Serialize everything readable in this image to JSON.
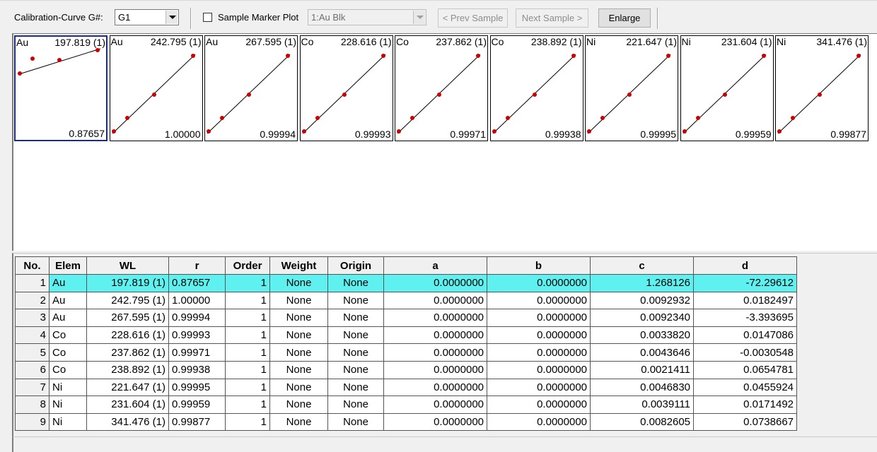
{
  "toolbar": {
    "calib_label": "Calibration-Curve G#:",
    "calib_value": "G1",
    "sample_marker_label": "Sample Marker Plot",
    "sample_marker_checked": false,
    "sample_value": "1:Au Blk",
    "prev_sample": "< Prev Sample",
    "next_sample": "Next Sample >",
    "enlarge": "Enlarge"
  },
  "curves": [
    {
      "elem": "Au",
      "wl": "197.819 (1)",
      "r": "0.87657",
      "selected": true
    },
    {
      "elem": "Au",
      "wl": "242.795 (1)",
      "r": "1.00000"
    },
    {
      "elem": "Au",
      "wl": "267.595 (1)",
      "r": "0.99994"
    },
    {
      "elem": "Co",
      "wl": "228.616 (1)",
      "r": "0.99993"
    },
    {
      "elem": "Co",
      "wl": "237.862 (1)",
      "r": "0.99971"
    },
    {
      "elem": "Co",
      "wl": "238.892 (1)",
      "r": "0.99938"
    },
    {
      "elem": "Ni",
      "wl": "221.647 (1)",
      "r": "0.99995"
    },
    {
      "elem": "Ni",
      "wl": "231.604 (1)",
      "r": "0.99959"
    },
    {
      "elem": "Ni",
      "wl": "341.476 (1)",
      "r": "0.99877"
    }
  ],
  "grid": {
    "headers": [
      "No.",
      "Elem",
      "WL",
      "r",
      "Order",
      "Weight",
      "Origin",
      "a",
      "b",
      "c",
      "d"
    ],
    "selected_row": 0,
    "rows": [
      [
        "1",
        "Au",
        "197.819 (1)",
        "0.87657",
        "1",
        "None",
        "None",
        "0.0000000",
        "0.0000000",
        "1.268126",
        "-72.29612"
      ],
      [
        "2",
        "Au",
        "242.795 (1)",
        "1.00000",
        "1",
        "None",
        "None",
        "0.0000000",
        "0.0000000",
        "0.0092932",
        "0.0182497"
      ],
      [
        "3",
        "Au",
        "267.595 (1)",
        "0.99994",
        "1",
        "None",
        "None",
        "0.0000000",
        "0.0000000",
        "0.0092340",
        "-3.393695"
      ],
      [
        "4",
        "Co",
        "228.616 (1)",
        "0.99993",
        "1",
        "None",
        "None",
        "0.0000000",
        "0.0000000",
        "0.0033820",
        "0.0147086"
      ],
      [
        "5",
        "Co",
        "237.862 (1)",
        "0.99971",
        "1",
        "None",
        "None",
        "0.0000000",
        "0.0000000",
        "0.0043646",
        "-0.0030548"
      ],
      [
        "6",
        "Co",
        "238.892 (1)",
        "0.99938",
        "1",
        "None",
        "None",
        "0.0000000",
        "0.0000000",
        "0.0021411",
        "0.0654781"
      ],
      [
        "7",
        "Ni",
        "221.647 (1)",
        "0.99995",
        "1",
        "None",
        "None",
        "0.0000000",
        "0.0000000",
        "0.0046830",
        "0.0455924"
      ],
      [
        "8",
        "Ni",
        "231.604 (1)",
        "0.99959",
        "1",
        "None",
        "None",
        "0.0000000",
        "0.0000000",
        "0.0039111",
        "0.0171492"
      ],
      [
        "9",
        "Ni",
        "341.476 (1)",
        "0.99877",
        "1",
        "None",
        "None",
        "0.0000000",
        "0.0000000",
        "0.0082605",
        "0.0738667"
      ]
    ]
  },
  "colors": {
    "selected_row": "#5ff0f0",
    "selected_curve_border": "#1f2a78",
    "curve_point": "#cc0000"
  }
}
